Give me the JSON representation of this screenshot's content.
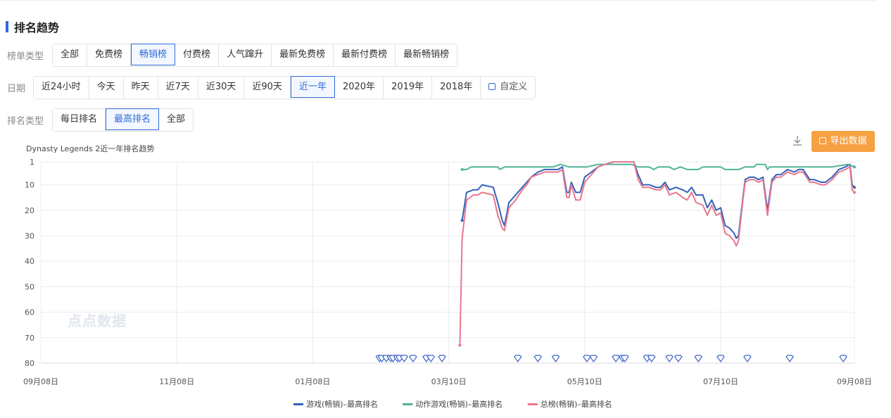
{
  "section": {
    "title": "排名趋势"
  },
  "filters": {
    "list_type": {
      "label": "榜单类型",
      "options": [
        "全部",
        "免费榜",
        "畅销榜",
        "付费榜",
        "人气蹿升",
        "最新免费榜",
        "最新付费榜",
        "最新畅销榜"
      ],
      "selected": "畅销榜"
    },
    "date": {
      "label": "日期",
      "options": [
        "近24小时",
        "今天",
        "昨天",
        "近7天",
        "近30天",
        "近90天",
        "近一年",
        "2020年",
        "2019年",
        "2018年"
      ],
      "custom_label": "自定义",
      "selected": "近一年"
    },
    "rank_type": {
      "label": "排名类型",
      "options": [
        "每日排名",
        "最高排名",
        "全部"
      ],
      "selected": "最高排名"
    }
  },
  "toolbar": {
    "export_label": "导出数据"
  },
  "watermark": "点点数据",
  "colors": {
    "accent": "#2f6bd6",
    "export": "#f6a142",
    "game": "#3561b8",
    "action": "#4fb39a",
    "total": "#e8778d"
  },
  "chart_data": {
    "type": "line",
    "title": "Dynasty Legends 2近一年排名趋势",
    "y_inverted": true,
    "ylim": [
      1,
      80
    ],
    "y_ticks": [
      1,
      10,
      20,
      30,
      40,
      50,
      60,
      70,
      80
    ],
    "x_days_total": 366,
    "x_ticks": [
      {
        "label": "09月08日",
        "day": 0
      },
      {
        "label": "11月08日",
        "day": 61
      },
      {
        "label": "01月08日",
        "day": 122
      },
      {
        "label": "03月10日",
        "day": 183
      },
      {
        "label": "05月10日",
        "day": 244
      },
      {
        "label": "07月10日",
        "day": 305
      },
      {
        "label": "09月08日",
        "day": 365
      }
    ],
    "grid": true,
    "legend_position": "bottom",
    "series": [
      {
        "name": "游戏(畅销)–最高排名",
        "color": "#3561b8",
        "points": [
          [
            189,
            24
          ],
          [
            191,
            13
          ],
          [
            194,
            12
          ],
          [
            196,
            12
          ],
          [
            198,
            10
          ],
          [
            203,
            11
          ],
          [
            205,
            17
          ],
          [
            207,
            24
          ],
          [
            208,
            26
          ],
          [
            210,
            17
          ],
          [
            213,
            14
          ],
          [
            216,
            11
          ],
          [
            218,
            9
          ],
          [
            220,
            7
          ],
          [
            223,
            5
          ],
          [
            226,
            4
          ],
          [
            228,
            4
          ],
          [
            232,
            4
          ],
          [
            234,
            3
          ],
          [
            236,
            13
          ],
          [
            237,
            13
          ],
          [
            238,
            9
          ],
          [
            240,
            13
          ],
          [
            242,
            13
          ],
          [
            244,
            7
          ],
          [
            247,
            5
          ],
          [
            250,
            3
          ],
          [
            253,
            2
          ],
          [
            257,
            1
          ],
          [
            260,
            1
          ],
          [
            262,
            1
          ],
          [
            264,
            1
          ],
          [
            266,
            1
          ],
          [
            268,
            6
          ],
          [
            270,
            10
          ],
          [
            273,
            10
          ],
          [
            276,
            11
          ],
          [
            278,
            11
          ],
          [
            280,
            9
          ],
          [
            282,
            12
          ],
          [
            285,
            11
          ],
          [
            288,
            12
          ],
          [
            290,
            13
          ],
          [
            292,
            11
          ],
          [
            294,
            14
          ],
          [
            297,
            14
          ],
          [
            299,
            19
          ],
          [
            301,
            16
          ],
          [
            303,
            20
          ],
          [
            305,
            19
          ],
          [
            307,
            26
          ],
          [
            309,
            27
          ],
          [
            311,
            29
          ],
          [
            312,
            31
          ],
          [
            313,
            30
          ],
          [
            315,
            15
          ],
          [
            316,
            8
          ],
          [
            318,
            7
          ],
          [
            320,
            7
          ],
          [
            322,
            8
          ],
          [
            324,
            7
          ],
          [
            326,
            20
          ],
          [
            328,
            8
          ],
          [
            330,
            6
          ],
          [
            332,
            6
          ],
          [
            335,
            4
          ],
          [
            338,
            5
          ],
          [
            340,
            4
          ],
          [
            342,
            4
          ],
          [
            345,
            8
          ],
          [
            347,
            8
          ],
          [
            350,
            9
          ],
          [
            352,
            9
          ],
          [
            355,
            7
          ],
          [
            358,
            4
          ],
          [
            361,
            3
          ],
          [
            363,
            2
          ],
          [
            364,
            10
          ],
          [
            365,
            11
          ]
        ]
      },
      {
        "name": "动作游戏(畅销)–最高排名",
        "color": "#4fb39a",
        "points": [
          [
            189,
            4
          ],
          [
            191,
            4
          ],
          [
            193,
            3
          ],
          [
            196,
            3
          ],
          [
            200,
            3
          ],
          [
            205,
            3
          ],
          [
            206,
            4
          ],
          [
            208,
            3
          ],
          [
            213,
            3
          ],
          [
            220,
            3
          ],
          [
            230,
            3
          ],
          [
            233,
            2
          ],
          [
            237,
            3
          ],
          [
            245,
            3
          ],
          [
            250,
            2
          ],
          [
            257,
            2
          ],
          [
            262,
            2
          ],
          [
            265,
            2
          ],
          [
            268,
            3
          ],
          [
            271,
            3
          ],
          [
            273,
            3
          ],
          [
            275,
            4
          ],
          [
            277,
            3
          ],
          [
            282,
            3
          ],
          [
            284,
            4
          ],
          [
            287,
            3
          ],
          [
            290,
            4
          ],
          [
            295,
            4
          ],
          [
            297,
            3
          ],
          [
            300,
            3
          ],
          [
            302,
            3
          ],
          [
            305,
            3
          ],
          [
            307,
            4
          ],
          [
            313,
            4
          ],
          [
            316,
            3
          ],
          [
            320,
            3
          ],
          [
            321,
            2
          ],
          [
            323,
            2
          ],
          [
            325,
            2
          ],
          [
            326,
            4
          ],
          [
            327,
            3
          ],
          [
            335,
            3
          ],
          [
            345,
            3
          ],
          [
            355,
            3
          ],
          [
            362,
            2
          ],
          [
            365,
            3
          ]
        ]
      },
      {
        "name": "总榜(畅销)–最高排名",
        "color": "#e8778d",
        "points": [
          [
            188,
            73
          ],
          [
            189,
            31
          ],
          [
            191,
            16
          ],
          [
            194,
            14
          ],
          [
            196,
            14
          ],
          [
            198,
            13
          ],
          [
            203,
            14
          ],
          [
            205,
            22
          ],
          [
            207,
            27
          ],
          [
            208,
            28
          ],
          [
            210,
            19
          ],
          [
            213,
            16
          ],
          [
            216,
            12
          ],
          [
            218,
            10
          ],
          [
            220,
            7
          ],
          [
            223,
            6
          ],
          [
            226,
            5
          ],
          [
            228,
            5
          ],
          [
            232,
            5
          ],
          [
            234,
            4
          ],
          [
            236,
            15
          ],
          [
            237,
            15
          ],
          [
            238,
            10
          ],
          [
            240,
            16
          ],
          [
            242,
            16
          ],
          [
            244,
            9
          ],
          [
            247,
            6
          ],
          [
            250,
            3
          ],
          [
            253,
            2
          ],
          [
            257,
            1
          ],
          [
            260,
            1
          ],
          [
            262,
            1
          ],
          [
            264,
            1
          ],
          [
            266,
            1
          ],
          [
            268,
            8
          ],
          [
            270,
            11
          ],
          [
            273,
            11
          ],
          [
            276,
            12
          ],
          [
            278,
            12
          ],
          [
            280,
            10
          ],
          [
            282,
            14
          ],
          [
            285,
            13
          ],
          [
            288,
            15
          ],
          [
            290,
            16
          ],
          [
            292,
            13
          ],
          [
            294,
            17
          ],
          [
            297,
            18
          ],
          [
            299,
            22
          ],
          [
            301,
            18
          ],
          [
            303,
            22
          ],
          [
            305,
            21
          ],
          [
            307,
            29
          ],
          [
            309,
            30
          ],
          [
            311,
            32
          ],
          [
            312,
            34
          ],
          [
            313,
            32
          ],
          [
            315,
            16
          ],
          [
            316,
            9
          ],
          [
            318,
            8
          ],
          [
            320,
            8
          ],
          [
            322,
            9
          ],
          [
            324,
            8
          ],
          [
            326,
            22
          ],
          [
            328,
            9
          ],
          [
            330,
            7
          ],
          [
            332,
            7
          ],
          [
            335,
            5
          ],
          [
            338,
            6
          ],
          [
            340,
            5
          ],
          [
            342,
            5
          ],
          [
            345,
            9
          ],
          [
            347,
            9
          ],
          [
            350,
            10
          ],
          [
            352,
            10
          ],
          [
            355,
            8
          ],
          [
            358,
            5
          ],
          [
            361,
            4
          ],
          [
            363,
            3
          ],
          [
            364,
            12
          ],
          [
            365,
            13
          ]
        ]
      }
    ],
    "event_days": [
      152,
      153,
      155,
      157,
      158,
      160,
      161,
      163,
      167,
      173,
      175,
      180,
      214,
      223,
      231,
      245,
      248,
      258,
      261,
      262,
      272,
      274,
      282,
      286,
      295,
      305,
      317,
      336,
      360
    ]
  }
}
